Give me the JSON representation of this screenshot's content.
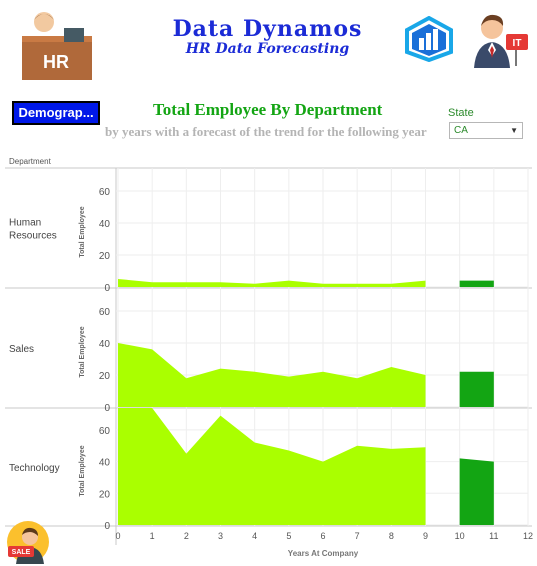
{
  "header": {
    "brand_line1": "Data Dynamos",
    "brand_line2": "HR Data Forecasting",
    "hr_badge_text": "HR",
    "it_badge_text": "IT",
    "sale_badge_text": "SALE",
    "icons": [
      "hr-desk-icon",
      "powerbi-logo-icon",
      "it-person-icon",
      "sale-person-icon"
    ]
  },
  "demographics_button": {
    "label": "Demograp..."
  },
  "title": "Total Employee By Department",
  "subtitle": "by years with a forecast of the trend for the following year",
  "filter": {
    "label": "State",
    "value": "CA"
  },
  "colors": {
    "actual": "#aaff00",
    "forecast": "#13a513",
    "title": "#13a513",
    "brand": "#1b2bd6",
    "button": "#0018e8"
  },
  "chart_data": {
    "type": "area",
    "column_header": "Department",
    "xlabel": "Years At Company",
    "ylabel": "Total Employee",
    "x_ticks": [
      "0",
      "1",
      "2",
      "3",
      "4",
      "5",
      "6",
      "7",
      "8",
      "9",
      "10",
      "11",
      "12"
    ],
    "ylim": [
      0,
      70
    ],
    "y_ticks": [
      0,
      20,
      40,
      60
    ],
    "grid": true,
    "panels": [
      {
        "department_label": [
          "Human",
          "Resources"
        ],
        "actual": {
          "x": [
            0,
            1,
            2,
            3,
            4,
            5,
            6,
            7,
            8,
            9
          ],
          "y": [
            5,
            3,
            3,
            3,
            2,
            4,
            2,
            2,
            2,
            4
          ]
        },
        "forecast": {
          "x": [
            10,
            11
          ],
          "y": [
            4,
            4
          ]
        }
      },
      {
        "department_label": [
          "Sales"
        ],
        "actual": {
          "x": [
            0,
            1,
            2,
            3,
            4,
            5,
            6,
            7,
            8,
            9
          ],
          "y": [
            40,
            36,
            18,
            24,
            22,
            19,
            22,
            18,
            25,
            20
          ]
        },
        "forecast": {
          "x": [
            10,
            11
          ],
          "y": [
            22,
            22
          ]
        }
      },
      {
        "department_label": [
          "Technology"
        ],
        "actual": {
          "x": [
            0,
            1,
            2,
            3,
            4,
            5,
            6,
            7,
            8,
            9
          ],
          "y": [
            75,
            75,
            45,
            69,
            52,
            47,
            40,
            50,
            48,
            49
          ]
        },
        "forecast": {
          "x": [
            10,
            11
          ],
          "y": [
            42,
            40
          ]
        }
      }
    ]
  }
}
